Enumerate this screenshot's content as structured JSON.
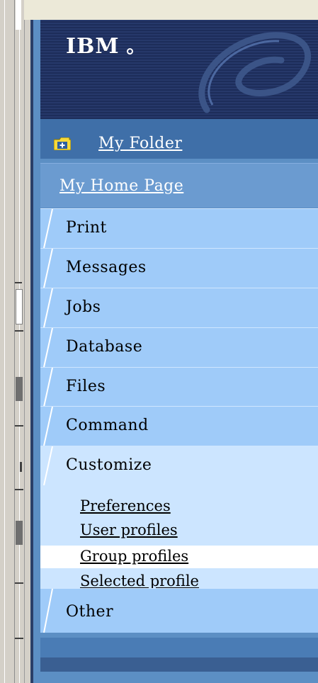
{
  "banner": {
    "logo_text": "IBM"
  },
  "folder": {
    "label": "My Folder"
  },
  "home": {
    "label": "My Home Page"
  },
  "nav_items": [
    {
      "label": "Print"
    },
    {
      "label": "Messages"
    },
    {
      "label": "Jobs"
    },
    {
      "label": "Database"
    },
    {
      "label": "Files"
    },
    {
      "label": "Command"
    },
    {
      "label": "Customize"
    },
    {
      "label": "Other"
    }
  ],
  "customize_subitems": [
    {
      "label": "Preferences"
    },
    {
      "label": "User profiles"
    },
    {
      "label": "Group profiles"
    },
    {
      "label": "Selected profile"
    }
  ],
  "highlighted_subitem": "Group profiles",
  "footer": {
    "label": ""
  },
  "colors": {
    "banner": "#1d2d5a",
    "folder_row": "#3f6fa8",
    "home_row": "#6b9bd0",
    "item_bg": "#9fcbf9",
    "active_item_bg": "#cce5ff",
    "highlight_bg": "#ffffff"
  }
}
